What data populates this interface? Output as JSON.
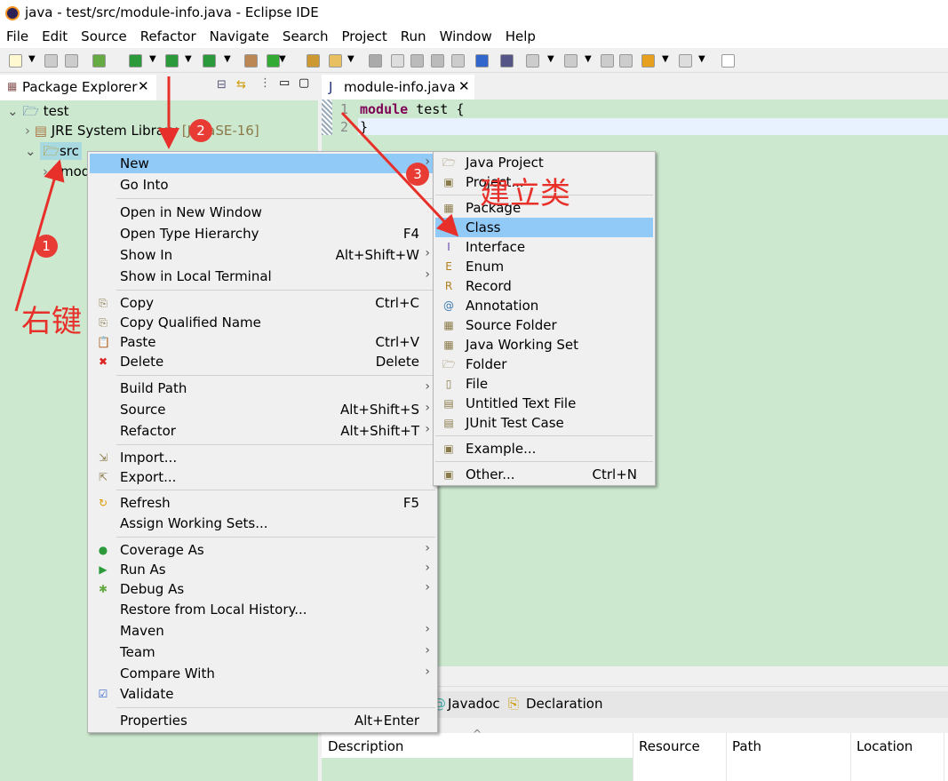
{
  "window": {
    "title": "java - test/src/module-info.java - Eclipse IDE"
  },
  "menubar": [
    "File",
    "Edit",
    "Source",
    "Refactor",
    "Navigate",
    "Search",
    "Project",
    "Run",
    "Window",
    "Help"
  ],
  "package_explorer": {
    "tab": "Package Explorer",
    "tree": [
      {
        "label": "test",
        "expanded": true
      },
      {
        "label": "JRE System Library",
        "suffix": "[JavaSE-16]"
      },
      {
        "label": "src",
        "expanded": true,
        "selected": true
      },
      {
        "label": "module-info.java"
      }
    ]
  },
  "editor": {
    "tab": "module-info.java",
    "lines": [
      {
        "n": "1",
        "kw": "module",
        "rest": " test {"
      },
      {
        "n": "2",
        "kw": "",
        "rest": "}"
      }
    ]
  },
  "bottom": {
    "tabs": [
      "Javadoc",
      "Declaration"
    ],
    "columns": [
      "Description",
      "Resource",
      "Path",
      "Location"
    ]
  },
  "context_menu": [
    {
      "label": "New",
      "submenu": true,
      "highlight": true
    },
    {
      "label": "Go Into"
    },
    {
      "label": "Open in New Window"
    },
    {
      "label": "Open Type Hierarchy",
      "shortcut": "F4"
    },
    {
      "label": "Show In",
      "shortcut": "Alt+Shift+W",
      "submenu": true
    },
    {
      "label": "Show in Local Terminal",
      "submenu": true
    },
    {
      "label": "Copy",
      "shortcut": "Ctrl+C",
      "icon": "copy-icon"
    },
    {
      "label": "Copy Qualified Name",
      "icon": "copy-qualified-icon"
    },
    {
      "label": "Paste",
      "shortcut": "Ctrl+V",
      "icon": "paste-icon"
    },
    {
      "label": "Delete",
      "shortcut": "Delete",
      "icon": "delete-icon"
    },
    {
      "label": "Build Path",
      "submenu": true
    },
    {
      "label": "Source",
      "shortcut": "Alt+Shift+S",
      "submenu": true
    },
    {
      "label": "Refactor",
      "shortcut": "Alt+Shift+T",
      "submenu": true
    },
    {
      "label": "Import...",
      "icon": "import-icon"
    },
    {
      "label": "Export...",
      "icon": "export-icon"
    },
    {
      "label": "Refresh",
      "shortcut": "F5",
      "icon": "refresh-icon"
    },
    {
      "label": "Assign Working Sets..."
    },
    {
      "label": "Coverage As",
      "submenu": true,
      "icon": "coverage-icon"
    },
    {
      "label": "Run As",
      "submenu": true,
      "icon": "run-icon"
    },
    {
      "label": "Debug As",
      "submenu": true,
      "icon": "debug-icon"
    },
    {
      "label": "Restore from Local History..."
    },
    {
      "label": "Maven",
      "submenu": true
    },
    {
      "label": "Team",
      "submenu": true
    },
    {
      "label": "Compare With",
      "submenu": true
    },
    {
      "label": "Validate",
      "icon": "check-icon"
    },
    {
      "label": "Properties",
      "shortcut": "Alt+Enter"
    }
  ],
  "new_submenu": [
    {
      "label": "Java Project",
      "icon": "java-project-icon"
    },
    {
      "label": "Project...",
      "icon": "project-icon"
    },
    {
      "label": "Package",
      "icon": "package-icon"
    },
    {
      "label": "Class",
      "icon": "class-icon",
      "highlight": true
    },
    {
      "label": "Interface",
      "icon": "interface-icon"
    },
    {
      "label": "Enum",
      "icon": "enum-icon"
    },
    {
      "label": "Record",
      "icon": "record-icon"
    },
    {
      "label": "Annotation",
      "icon": "annotation-icon"
    },
    {
      "label": "Source Folder",
      "icon": "source-folder-icon"
    },
    {
      "label": "Java Working Set",
      "icon": "working-set-icon"
    },
    {
      "label": "Folder",
      "icon": "folder-icon"
    },
    {
      "label": "File",
      "icon": "file-icon"
    },
    {
      "label": "Untitled Text File",
      "icon": "text-file-icon"
    },
    {
      "label": "JUnit Test Case",
      "icon": "junit-icon"
    },
    {
      "label": "Example...",
      "icon": "example-icon"
    },
    {
      "label": "Other...",
      "shortcut": "Ctrl+N",
      "icon": "other-icon"
    }
  ],
  "annotations": {
    "right_click": "右键",
    "create_class": "建立类",
    "steps": [
      "1",
      "2",
      "3"
    ],
    "color": "#e8302a"
  }
}
